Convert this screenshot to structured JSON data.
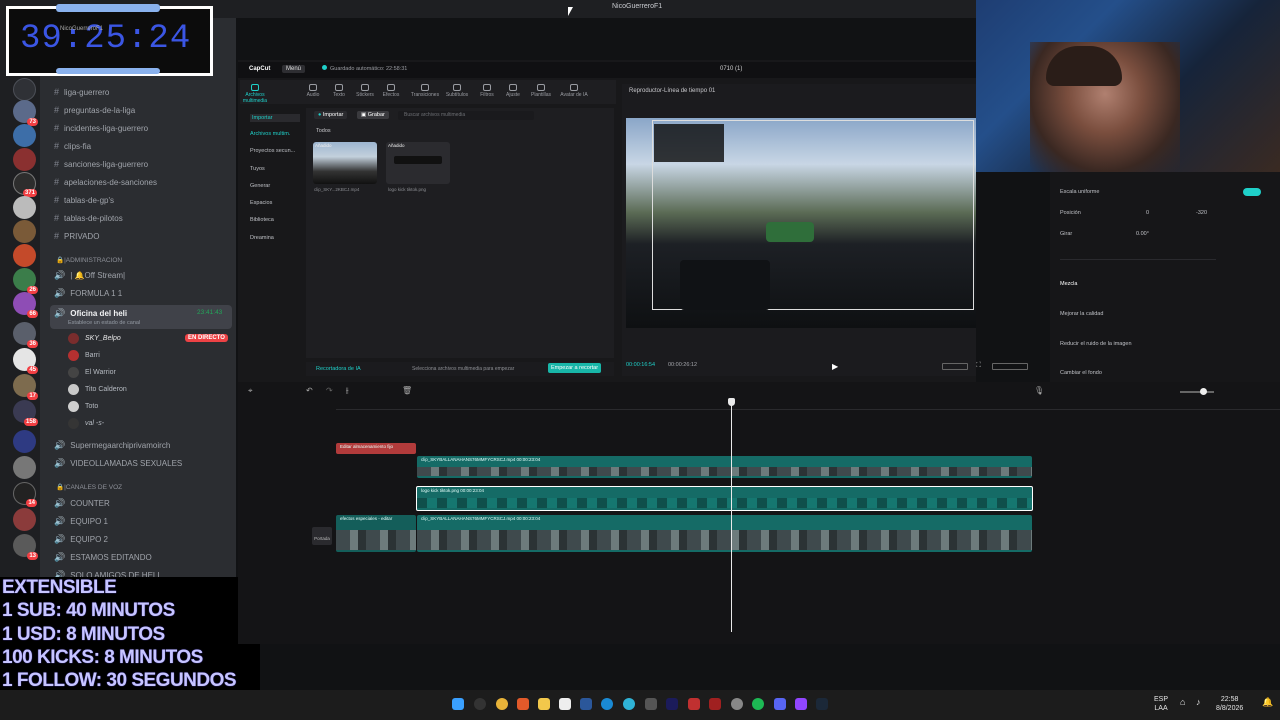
{
  "window": {
    "title": "NicoGuerreroF1"
  },
  "timer": {
    "value": "39:25:24",
    "subtitle": "NicoGuerreroF1"
  },
  "discord": {
    "channels": [
      {
        "name": "liga-guerrero"
      },
      {
        "name": "preguntas-de-la-liga"
      },
      {
        "name": "incidentes-liga-guerrero"
      },
      {
        "name": "clips-fia"
      },
      {
        "name": "sanciones-liga-guerrero"
      },
      {
        "name": "apelaciones-de-sanciones"
      },
      {
        "name": "tablas-de-gp's"
      },
      {
        "name": "tablas-de-pilotos"
      },
      {
        "name": "PRIVADO"
      }
    ],
    "category_admin": "|ADMINISTRACION",
    "off_stream": "| 🔔Off Stream|",
    "formula": "FORMULA 1 1",
    "voice_active": {
      "name": "Oficina del heli",
      "time": "23:41:43",
      "status": "Establece un estado de canal"
    },
    "voice_users": [
      {
        "name": "SKY_Belpo",
        "live": "EN DIRECTO"
      },
      {
        "name": "Barri"
      },
      {
        "name": "El Warrior"
      },
      {
        "name": "Tito Calderon"
      },
      {
        "name": "Toto"
      },
      {
        "name": "val -s-"
      }
    ],
    "more_channels": [
      "Supermegaarchiprivamoirch",
      "VIDEOLLAMADAS SEXUALES"
    ],
    "category_voice": "|CANALES DE VOZ",
    "voice_channels": [
      "COUNTER",
      "EQUIPO 1",
      "EQUIPO 2",
      "ESTAMOS EDITANDO",
      "SOLO AMIGOS DE HELI"
    ],
    "server_badges": [
      "73",
      "371",
      "26",
      "66",
      "36",
      "45",
      "17",
      "158",
      "14",
      "13"
    ]
  },
  "overlay": {
    "lines": [
      "EXTENSIBLE",
      "1 SUB: 40 MINUTOS",
      "1 USD: 8 MINUTOS",
      "100 KICKS: 8 MINUTOS",
      "1 FOLLOW: 30 SEGUNDOS"
    ]
  },
  "editor": {
    "app": "CapCut",
    "menu": "Menú",
    "autosave": "Guardado automático: 22:58:31",
    "project": "0710 (1)",
    "tools": [
      "Archivos multimedia",
      "Audio",
      "Texto",
      "Stickers",
      "Efectos",
      "Transiciones",
      "Subtítulos",
      "Filtros",
      "Ajuste",
      "Plantillas",
      "Avatar de IA"
    ],
    "media_side": [
      "Importar",
      "Archivos multim.",
      "Proyectos secun...",
      "Tuyos",
      "Generar",
      "Espacios",
      "Biblioteca",
      "Dreamina"
    ],
    "import_label": "Importar",
    "record_label": "Grabar",
    "search_placeholder": "Buscar archivos multimedia",
    "all_label": "Todos",
    "added_label": "Añadido",
    "files": [
      {
        "name": "clip_SKY...2KBCJ.mp4"
      },
      {
        "name": "logo kick tiktok.png"
      }
    ],
    "ai_recorder": "Recortadora de IA",
    "select_hint": "Selecciona archivos multimedia para empezar",
    "start_button": "Empezar a recortar",
    "player_title": "Reproductor-Línea de tiempo 01",
    "time_current": "00:00:16:54",
    "time_total": "00:00:26:12",
    "props": {
      "scale": "Escala uniforme",
      "position": "Posición",
      "pos_x": "0",
      "pos_y": "-320",
      "rotate": "Girar",
      "rotate_val": "0.00°",
      "blend": "Mezcla",
      "quality": "Mejorar la calidad",
      "noise": "Reducir el ruido de la imagen",
      "background": "Cambiar el fondo"
    },
    "clips": {
      "text": "Editar almacenamiento fijo",
      "video1": "clip_SKYBALLANAHANS76MMFYCRSCJ.mp4  00:00:23:04",
      "logo": "logo kick tiktok.png  00:00:23:04",
      "main": "clip_SKYBALLANAHANS76MMFYCRSCJ.mp4  00:00:23:04",
      "fx1": "efectos especiales - editar",
      "fx2": "efectos especiales - editar",
      "cover": "Portada"
    }
  },
  "taskbar": {
    "lang": "ESP",
    "layout": "LAA",
    "time": "22:58",
    "date": "8/8/2026"
  }
}
